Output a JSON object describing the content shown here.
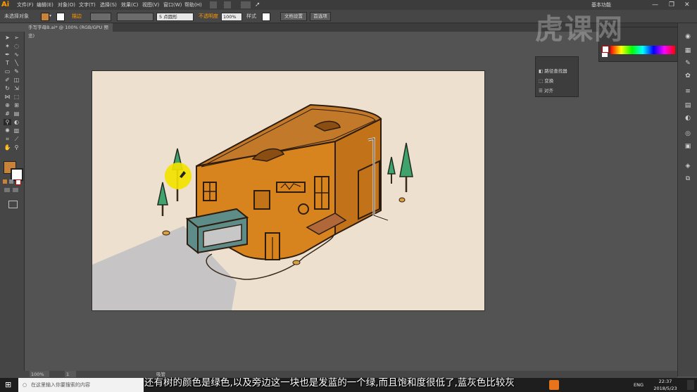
{
  "app": {
    "logo": "Ai"
  },
  "menus": [
    "文件(F)",
    "编辑(E)",
    "对象(O)",
    "文字(T)",
    "选择(S)",
    "效果(C)",
    "视图(V)",
    "窗口(W)",
    "帮助(H)"
  ],
  "workspace": {
    "label": "基本功能"
  },
  "control_bar": {
    "selection_label": "未选择对象",
    "stroke_label": "描边",
    "brush_label": "5 点圆形",
    "opacity_label": "不透明度",
    "opacity_value": "100%",
    "style_label": "样式",
    "doc_settings_button": "文档设置",
    "preferences_button": "首选项"
  },
  "document_tab": {
    "title": "手写字母B.ai* @ 100% (RGB/GPU 预览)"
  },
  "float_panel": {
    "items": [
      "路径查找器",
      "变换",
      "对齐"
    ]
  },
  "status_bar": {
    "zoom": "100%",
    "page": "1",
    "tool": "吸管"
  },
  "taskbar": {
    "search_placeholder": "在这里输入你要搜索的内容",
    "lang": "ENG",
    "time": "22:37",
    "date": "2018/5/23"
  },
  "subtitle": {
    "text": "还有树的颜色是绿色,以及旁边这一块也是发蓝的一个绿,而且饱和度很低了,蓝灰色比较灰"
  },
  "watermark": {
    "text": "虎课网"
  },
  "colors": {
    "fill": "#c8823a",
    "artboard": "#ede0cf",
    "building": "#d8841e",
    "roof": "#c27a2a",
    "tree": "#3fa36b",
    "shadow": "#c6c4c4",
    "awning": "#5e8c89",
    "cursor_highlight": "#f2e200"
  },
  "icons": [
    "search-icon",
    "windows-icon",
    "eyedropper-icon",
    "selection-icon",
    "pen-icon",
    "type-icon",
    "hand-icon",
    "zoom-icon"
  ]
}
